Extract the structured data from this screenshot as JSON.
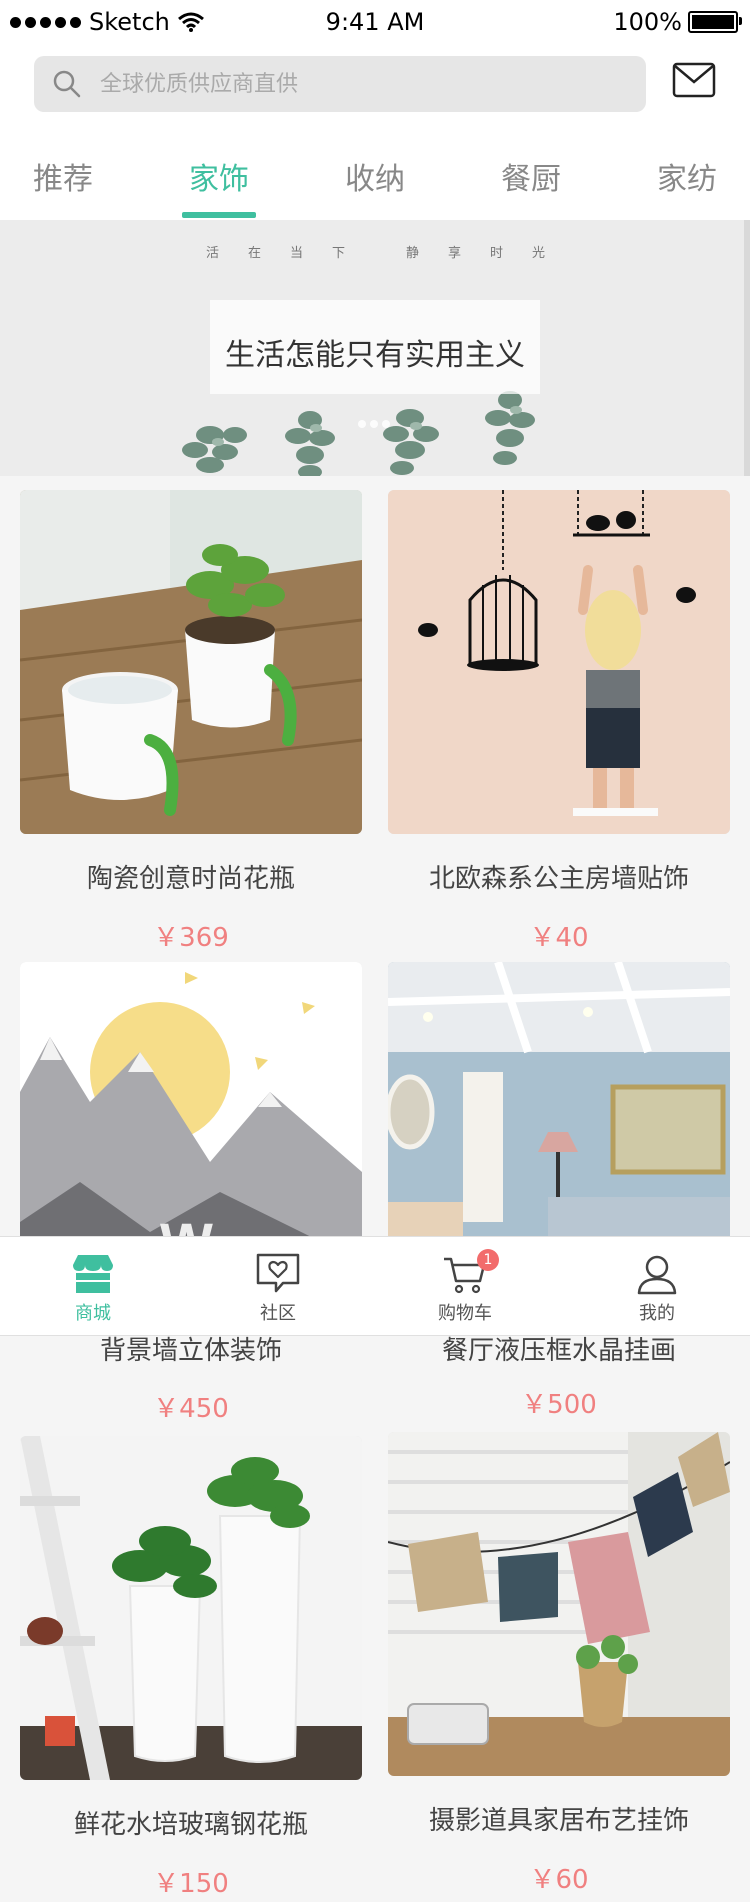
{
  "status_bar": {
    "carrier": "Sketch",
    "time": "9:41 AM",
    "battery": "100%"
  },
  "search": {
    "placeholder": "全球优质供应商直供"
  },
  "tabs": [
    "推荐",
    "家饰",
    "收纳",
    "餐厨",
    "家纺"
  ],
  "active_tab": "家饰",
  "banner": {
    "subtitle_chars": [
      "活",
      "在",
      "当",
      "下",
      "静",
      "享",
      "时",
      "光"
    ],
    "slogan": "生活怎能只有实用主义"
  },
  "products": [
    {
      "name": "陶瓷创意时尚花瓶",
      "price": "￥369",
      "photo": "ceramic-vase-photo"
    },
    {
      "name": "北欧森系公主房墙贴饰",
      "price": "￥40",
      "photo": "wall-sticker-photo"
    },
    {
      "name": "背景墙立体装饰",
      "price": "￥450",
      "photo": "mountain-wall-photo"
    },
    {
      "name": "餐厅液压框水晶挂画",
      "price": "￥500",
      "photo": "living-room-photo"
    },
    {
      "name": "鲜花水培玻璃钢花瓶",
      "price": "￥150",
      "photo": "white-planter-photo"
    },
    {
      "name": "摄影道具家居布艺挂饰",
      "price": "￥60",
      "photo": "fabric-bunting-photo"
    }
  ],
  "tab_bar": {
    "items": [
      {
        "label": "商城",
        "icon": "store-icon"
      },
      {
        "label": "社区",
        "icon": "heart-chat-icon"
      },
      {
        "label": "购物车",
        "icon": "cart-icon",
        "badge": "1"
      },
      {
        "label": "我的",
        "icon": "user-icon"
      }
    ],
    "active": "商城"
  },
  "colors": {
    "accent": "#3fbf9f",
    "price": "#f08080",
    "badge": "#f26b6b"
  }
}
